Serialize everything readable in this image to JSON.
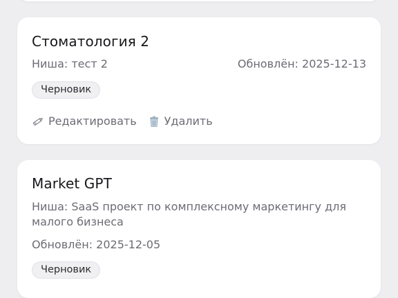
{
  "projects": [
    {
      "title": "Стоматология 2",
      "niche": "Ниша: тест 2",
      "updated": "Обновлён: 2025-12-13",
      "status": "Черновик",
      "edit_label": "Редактировать",
      "delete_label": "Удалить"
    },
    {
      "title": "Market GPT",
      "niche": "Ниша: SaaS проект по комплексному маркетингу для малого бизнеса",
      "updated": "Обновлён: 2025-12-05",
      "status": "Черновик"
    }
  ],
  "icons": {
    "edit": "pencil-icon",
    "delete": "trash-icon"
  },
  "colors": {
    "background": "#eeeef1",
    "card": "#ffffff",
    "muted_text": "#6b6b74",
    "badge_bg": "#f0f0f3"
  }
}
